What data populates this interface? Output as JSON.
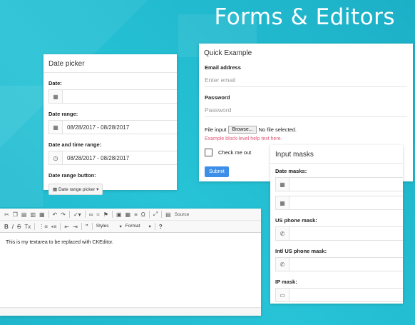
{
  "hero_title": "Forms & Editors",
  "date_picker": {
    "title": "Date picker",
    "date_label": "Date:",
    "date_value": "",
    "range_label": "Date range:",
    "range_value": "08/28/2017 - 08/28/2017",
    "time_range_label": "Date and time range:",
    "time_range_value": "08/28/2017 - 08/28/2017",
    "button_label_title": "Date range button:",
    "button_label": "Date range picker",
    "icons": [
      "calendar-icon",
      "clock-icon",
      "caret-down-icon"
    ]
  },
  "quick": {
    "title": "Quick Example",
    "email_label": "Email address",
    "email_placeholder": "Enter email",
    "password_label": "Password",
    "password_placeholder": "Password",
    "file_label": "File input",
    "browse_label": "Browse...",
    "file_status": "No file selected.",
    "help_text": "Example block-level help text here.",
    "check_label": "Check me out",
    "submit_label": "Submit",
    "accent": "#3d8ee8",
    "help_color": "#e25a78"
  },
  "masks": {
    "title": "Input masks",
    "date_label": "Date masks:",
    "phone_label": "US phone mask:",
    "intl_label": "Intl US phone mask:",
    "ip_label": "IP mask:",
    "icons": [
      "calendar-icon",
      "phone-icon",
      "laptop-icon"
    ]
  },
  "editor": {
    "styles_label": "Styles",
    "format_label": "Format",
    "source_label": "Source",
    "help_label": "?",
    "content": "This is my textarea to be replaced with CKEditor."
  }
}
